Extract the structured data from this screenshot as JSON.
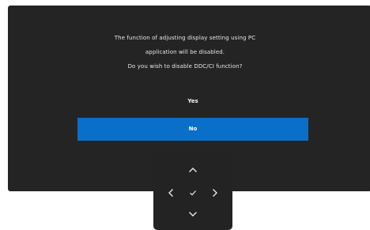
{
  "dialog": {
    "message_lines": [
      "The function of adjusting display setting using PC",
      "application will be disabled.",
      "Do you wish to disable DDC/CI function?"
    ],
    "options": {
      "yes_label": "Yes",
      "no_label": "No",
      "selected": "No"
    }
  },
  "joystick": {
    "icons": {
      "up": "chevron-up-icon",
      "down": "chevron-down-icon",
      "left": "chevron-left-icon",
      "right": "chevron-right-icon",
      "ok": "checkmark-icon"
    }
  },
  "colors": {
    "panel_background": "#242424",
    "selected_option": "#0a6fc8",
    "text": "#e6e6e6",
    "page_background": "#ffffff"
  }
}
